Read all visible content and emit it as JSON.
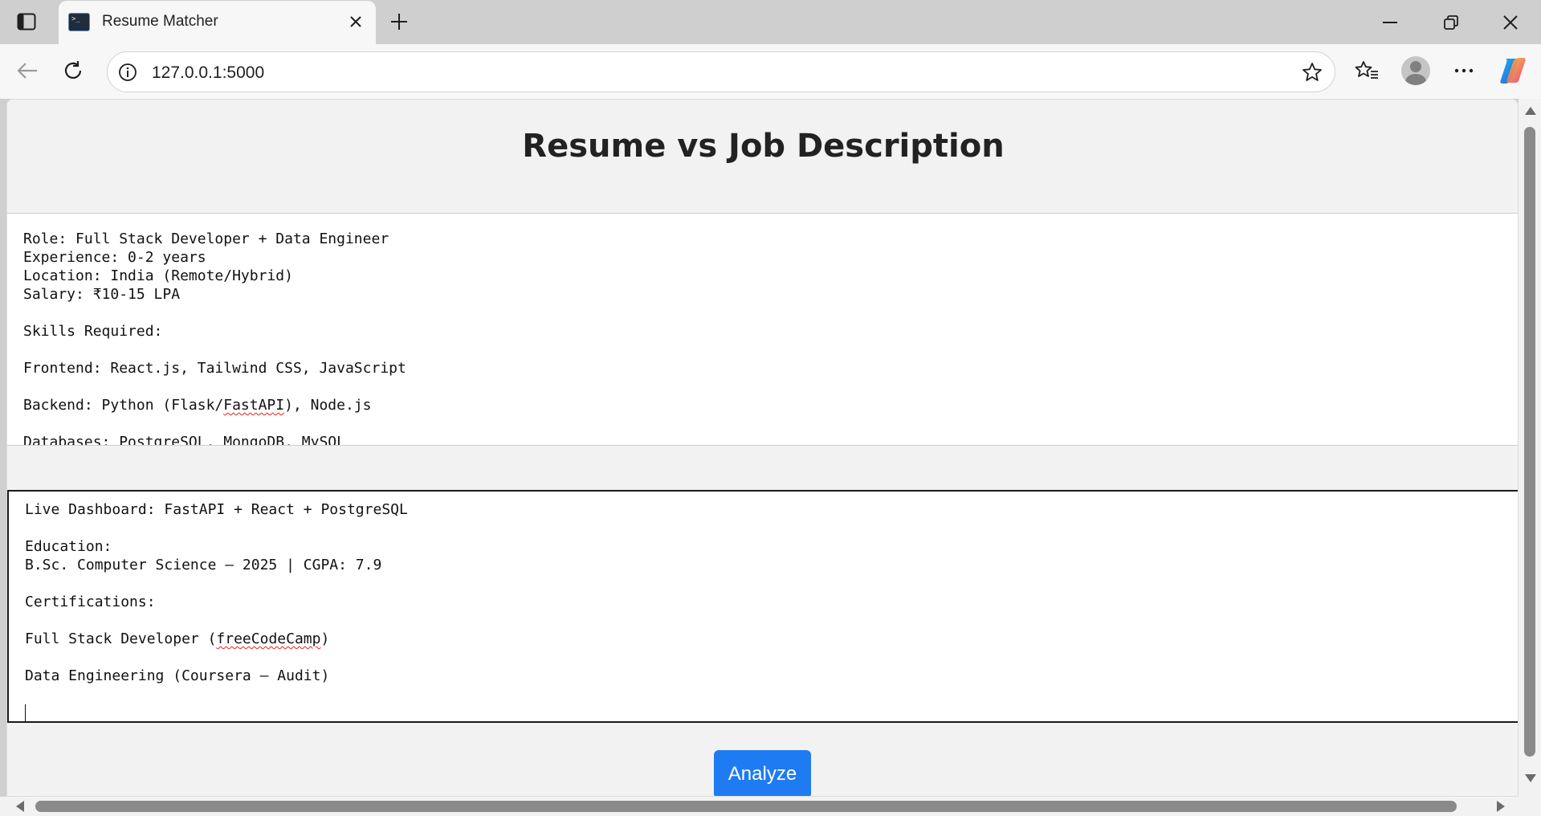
{
  "browser": {
    "tab_title": "Resume Matcher",
    "url": "127.0.0.1:5000",
    "colors": {
      "frame": "#cfcfcf",
      "toolbar": "#f7f7f7"
    }
  },
  "page": {
    "title": "Resume vs Job Description",
    "job_description_text": "Role: Full Stack Developer + Data Engineer\nExperience: 0-2 years\nLocation: India (Remote/Hybrid)\nSalary: ₹10-15 LPA\n\nSkills Required:\n\nFrontend: React.js, Tailwind CSS, JavaScript\n\nBackend: Python (Flask/",
    "job_description_misspelled": "FastAPI",
    "job_description_tail": "), Node.js\n\nDatabases: PostgreSQL, MongoDB, MySQL",
    "resume_text": "Live Dashboard: FastAPI + React + PostgreSQL\n\nEducation:\nB.Sc. Computer Science – 2025 | CGPA: 7.9\n\nCertifications:\n\nFull Stack Developer (",
    "resume_misspelled": "freeCodeCamp",
    "resume_tail": ")\n\nData Engineering (Coursera – Audit)\n\n",
    "analyze_label": "Analyze",
    "colors": {
      "background": "#f2f2f2",
      "button": "#1e7bf2",
      "spellcheck": "#e0241b"
    }
  },
  "icons": {
    "tab_actions": "tab-actions-icon",
    "close_tab": "close-icon",
    "new_tab": "plus-icon",
    "back": "back-arrow-icon",
    "reload": "reload-icon",
    "site_info": "info-icon",
    "favorite": "star-icon",
    "favorites": "favorites-icon",
    "profile": "avatar",
    "more": "more-icon",
    "copilot": "copilot-icon"
  }
}
